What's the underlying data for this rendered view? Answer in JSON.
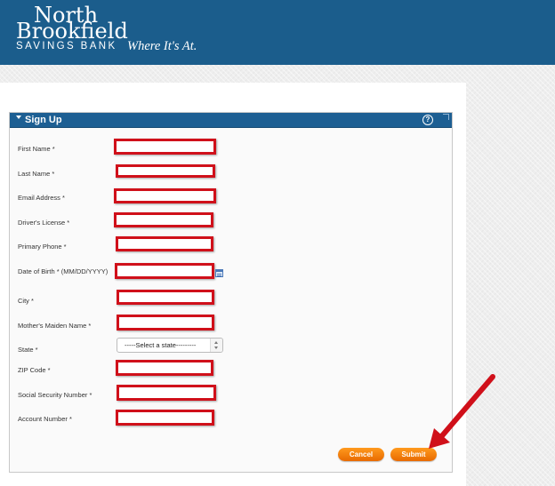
{
  "brand": {
    "line1": "North",
    "line2": "Brookfield",
    "line3": "SAVINGS BANK",
    "tagline": "Where It's At.",
    "header_color": "#1b5d8c"
  },
  "panel": {
    "title": "Sign Up",
    "help_icon": "help-circle-icon"
  },
  "fields": [
    {
      "label": "First Name *"
    },
    {
      "label": "Last Name *"
    },
    {
      "label": "Email Address *"
    },
    {
      "label": "Driver's License *"
    },
    {
      "label": "Primary Phone *"
    },
    {
      "label": "Date of Birth * (MM/DD/YYYY)"
    },
    {
      "label": "City *"
    },
    {
      "label": "Mother's Maiden Name *"
    },
    {
      "label": "State *"
    },
    {
      "label": "ZIP Code *"
    },
    {
      "label": "Social  Security Number *"
    },
    {
      "label": "Account Number *"
    }
  ],
  "state_select": {
    "value": "-----Select a state---------"
  },
  "buttons": {
    "cancel": "Cancel",
    "submit": "Submit"
  },
  "colors": {
    "highlight_red": "#d0101a",
    "button_orange": "#f07800"
  }
}
